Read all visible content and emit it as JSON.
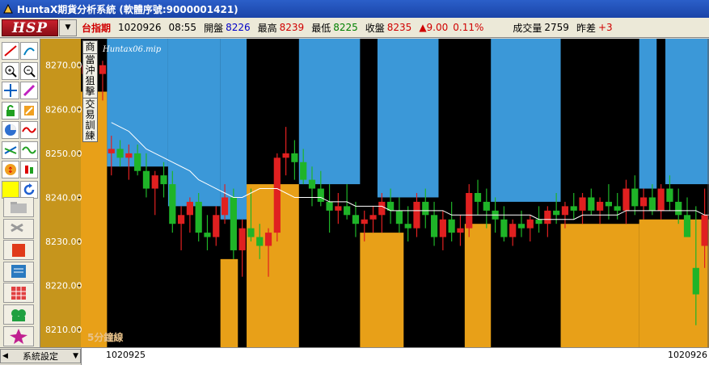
{
  "window": {
    "title": "HuntaX期貨分析系統 (軟體序號:9000001421)"
  },
  "header": {
    "logo": "HSP",
    "symbol": "台指期",
    "date": "1020926",
    "time": "08:55",
    "open_label": "開盤",
    "open": "8226",
    "high_label": "最高",
    "high": "8239",
    "low_label": "最低",
    "low": "8225",
    "close_label": "收盤",
    "close": "8235",
    "change": "▲9.00",
    "change_pct": "0.11%",
    "volume_label": "成交量",
    "volume": "2759",
    "spread_label": "昨差",
    "spread": "+3"
  },
  "side_menu": {
    "item1": [
      "商"
    ],
    "item2": [
      "當",
      "沖",
      "狙",
      "擊"
    ],
    "item3": [
      "交",
      "易",
      "訓",
      "練"
    ]
  },
  "toolbar": {
    "icons": [
      "trend-line-icon",
      "fibonacci-icon",
      "zoom-in-icon",
      "zoom-out-icon",
      "crosshair-icon",
      "pen-icon",
      "lock-icon",
      "edit-icon",
      "pie-chart-icon",
      "wave-icon",
      "channel-icon",
      "oscillator-icon",
      "shift-icon",
      "candle-icon",
      "yellow-box-icon",
      "refresh-icon",
      "folder-icon",
      "settings-tool-icon",
      "record-icon",
      "list-icon",
      "table-icon",
      "group-icon",
      "alert-icon"
    ]
  },
  "bottom": {
    "settings_label": "系統設定",
    "date_start": "1020925",
    "date_end": "1020926"
  },
  "chart_data": {
    "type": "candlestick",
    "overlay_label": "Huntax06.mip",
    "period_label": "5分鐘線",
    "y_ticks": [
      "8270.00",
      "8260.00",
      "8250.00",
      "8240.00",
      "8230.00",
      "8220.00",
      "8210.00"
    ],
    "ylim": [
      8206,
      8276
    ],
    "colors": {
      "background": "#000000",
      "bull": "#e02020",
      "bear": "#1fb428",
      "ma": "#ffffff",
      "orange_fill": "#e8a018",
      "blue_fill": "#3b98d8",
      "axis_bg": "#c6951c"
    },
    "candles": [
      [
        8268,
        8272,
        8265,
        8270
      ],
      [
        8270,
        8272,
        8267,
        8268
      ],
      [
        8268,
        8271,
        8262,
        8270
      ],
      [
        8250,
        8254,
        8245,
        8251
      ],
      [
        8251,
        8253,
        8247,
        8249
      ],
      [
        8249,
        8252,
        8244,
        8250
      ],
      [
        8250,
        8252,
        8245,
        8246
      ],
      [
        8246,
        8250,
        8240,
        8242
      ],
      [
        8242,
        8246,
        8236,
        8245
      ],
      [
        8245,
        8248,
        8240,
        8243
      ],
      [
        8243,
        8246,
        8232,
        8234
      ],
      [
        8234,
        8238,
        8228,
        8236
      ],
      [
        8236,
        8240,
        8232,
        8239
      ],
      [
        8239,
        8241,
        8230,
        8232
      ],
      [
        8232,
        8236,
        8228,
        8231
      ],
      [
        8231,
        8238,
        8229,
        8236
      ],
      [
        8236,
        8243,
        8234,
        8240
      ],
      [
        8240,
        8242,
        8226,
        8228
      ],
      [
        8228,
        8235,
        8222,
        8233
      ],
      [
        8233,
        8242,
        8230,
        8231
      ],
      [
        8231,
        8234,
        8226,
        8229
      ],
      [
        8229,
        8233,
        8222,
        8232
      ],
      [
        8232,
        8250,
        8230,
        8249
      ],
      [
        8249,
        8256,
        8245,
        8250
      ],
      [
        8250,
        8253,
        8244,
        8248
      ],
      [
        8248,
        8251,
        8243,
        8244
      ],
      [
        8244,
        8247,
        8238,
        8242
      ],
      [
        8242,
        8246,
        8238,
        8239
      ],
      [
        8239,
        8243,
        8232,
        8237
      ],
      [
        8237,
        8241,
        8234,
        8238
      ],
      [
        8238,
        8243,
        8235,
        8236
      ],
      [
        8236,
        8239,
        8231,
        8234
      ],
      [
        8234,
        8237,
        8230,
        8235
      ],
      [
        8235,
        8238,
        8232,
        8236
      ],
      [
        8236,
        8241,
        8232,
        8239
      ],
      [
        8239,
        8242,
        8234,
        8237
      ],
      [
        8237,
        8240,
        8232,
        8234
      ],
      [
        8234,
        8238,
        8230,
        8233
      ],
      [
        8233,
        8241,
        8231,
        8239
      ],
      [
        8239,
        8242,
        8233,
        8236
      ],
      [
        8236,
        8239,
        8229,
        8231
      ],
      [
        8231,
        8237,
        8228,
        8235
      ],
      [
        8235,
        8239,
        8230,
        8232
      ],
      [
        8232,
        8236,
        8229,
        8233
      ],
      [
        8233,
        8243,
        8231,
        8241
      ],
      [
        8241,
        8244,
        8236,
        8239
      ],
      [
        8239,
        8242,
        8233,
        8237
      ],
      [
        8237,
        8240,
        8232,
        8235
      ],
      [
        8235,
        8238,
        8230,
        8231
      ],
      [
        8231,
        8235,
        8229,
        8234
      ],
      [
        8234,
        8237,
        8231,
        8233
      ],
      [
        8233,
        8236,
        8230,
        8235
      ],
      [
        8235,
        8238,
        8232,
        8234
      ],
      [
        8234,
        8238,
        8231,
        8237
      ],
      [
        8237,
        8241,
        8234,
        8236
      ],
      [
        8236,
        8239,
        8233,
        8238
      ],
      [
        8238,
        8241,
        8235,
        8237
      ],
      [
        8237,
        8241,
        8234,
        8240
      ],
      [
        8240,
        8242,
        8236,
        8237
      ],
      [
        8237,
        8240,
        8234,
        8239
      ],
      [
        8239,
        8243,
        8235,
        8238
      ],
      [
        8238,
        8241,
        8235,
        8237
      ],
      [
        8237,
        8244,
        8234,
        8242
      ],
      [
        8242,
        8245,
        8236,
        8238
      ],
      [
        8238,
        8242,
        8235,
        8240
      ],
      [
        8240,
        8243,
        8236,
        8237
      ],
      [
        8237,
        8243,
        8235,
        8242
      ],
      [
        8242,
        8245,
        8237,
        8239
      ],
      [
        8239,
        8242,
        8234,
        8236
      ],
      [
        8236,
        8240,
        8232,
        8231
      ],
      [
        8224,
        8238,
        8211,
        8218
      ],
      [
        8229,
        8242,
        8224,
        8236
      ]
    ],
    "ma": [
      8257,
      8256,
      8255,
      8253,
      8251,
      8250,
      8249,
      8248,
      8247,
      8246,
      8244,
      8243,
      8242,
      8241,
      8240,
      8240,
      8241,
      8242,
      8242,
      8242,
      8241,
      8240,
      8240,
      8240,
      8240,
      8239,
      8239,
      8239,
      8238,
      8238,
      8238,
      8238,
      8237,
      8237,
      8237,
      8237,
      8237,
      8237,
      8237,
      8236,
      8236,
      8236,
      8236,
      8236,
      8236,
      8236,
      8236,
      8236,
      8236,
      8235,
      8235,
      8235,
      8235,
      8235,
      8236,
      8236,
      8236,
      8236,
      8236,
      8237,
      8237,
      8237,
      8237,
      8237,
      8237,
      8237,
      8237,
      8237,
      8236,
      8236,
      8235
    ],
    "regions": [
      {
        "color": "blue",
        "start": 0,
        "end": 3,
        "level": 8276
      },
      {
        "color": "orange",
        "start": 0,
        "end": 3,
        "level": 8264
      },
      {
        "color": "blue",
        "start": 3,
        "end": 10,
        "level": 8247
      },
      {
        "color": "blue",
        "start": 10,
        "end": 16,
        "level": 8238
      },
      {
        "color": "orange",
        "start": 16,
        "end": 18,
        "level": 8226
      },
      {
        "color": "blue",
        "start": 16,
        "end": 19,
        "level": 8235
      },
      {
        "color": "orange",
        "start": 19,
        "end": 25,
        "level": 8243
      },
      {
        "color": "blue",
        "start": 25,
        "end": 32,
        "level": 8243
      },
      {
        "color": "orange",
        "start": 32,
        "end": 37,
        "level": 8232
      },
      {
        "color": "blue",
        "start": 34,
        "end": 41,
        "level": 8240
      },
      {
        "color": "orange",
        "start": 44,
        "end": 47,
        "level": 8234
      },
      {
        "color": "blue",
        "start": 47,
        "end": 55,
        "level": 8239
      },
      {
        "color": "orange",
        "start": 55,
        "end": 64,
        "level": 8234
      },
      {
        "color": "blue",
        "start": 64,
        "end": 66,
        "level": 8242
      },
      {
        "color": "orange",
        "start": 64,
        "end": 73,
        "level": 8235
      },
      {
        "color": "blue",
        "start": 67,
        "end": 72,
        "level": 8243
      }
    ]
  }
}
